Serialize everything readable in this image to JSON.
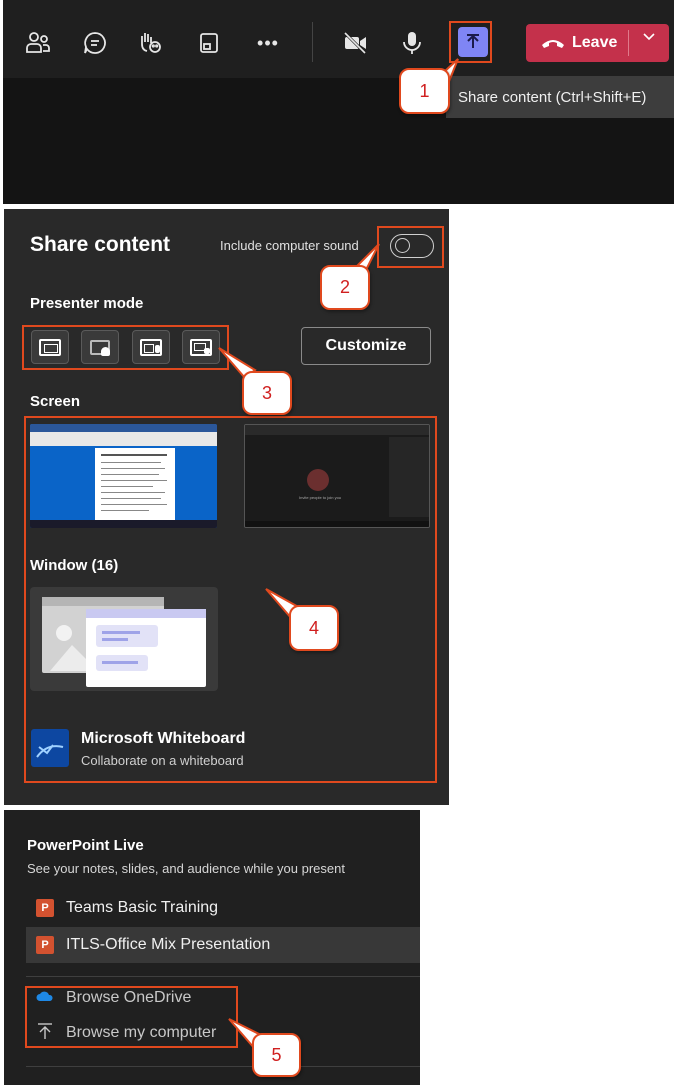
{
  "toolbar": {
    "icons": [
      "people-icon",
      "chat-icon",
      "raise-hand-icon",
      "rooms-icon",
      "more-icon",
      "camera-off-icon",
      "mic-icon",
      "share-icon"
    ],
    "more_glyph": "•••",
    "leave_label": "Leave",
    "tooltip": "Share content (Ctrl+Shift+E)"
  },
  "callouts": [
    "1",
    "2",
    "3",
    "4",
    "5"
  ],
  "share_panel": {
    "title": "Share content",
    "sound_label": "Include computer sound",
    "presenter_mode_label": "Presenter mode",
    "customize_label": "Customize",
    "screen_label": "Screen",
    "screen2_caption": "Invite people to join you",
    "window_label": "Window (16)",
    "whiteboard_title": "Microsoft Whiteboard",
    "whiteboard_subtitle": "Collaborate on a whiteboard"
  },
  "ppt_panel": {
    "title": "PowerPoint Live",
    "subtitle": "See your notes, slides, and audience while you present",
    "files": [
      "Teams Basic Training",
      "ITLS-Office Mix Presentation"
    ],
    "browse_onedrive": "Browse OneDrive",
    "browse_computer": "Browse my computer"
  },
  "colors": {
    "accent": "#7f85f5",
    "leave": "#c4314b",
    "highlight": "#e0491e",
    "callout_text": "#d02020",
    "powerpoint": "#d35230"
  }
}
